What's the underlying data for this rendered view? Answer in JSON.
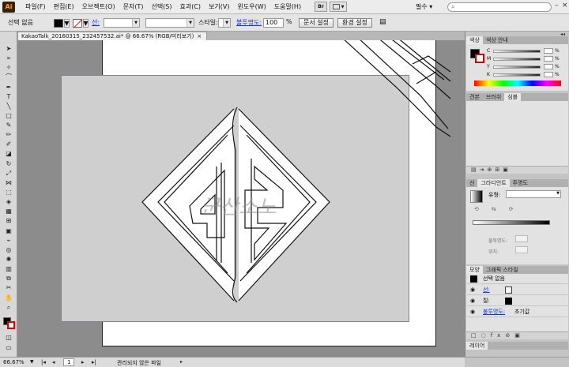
{
  "app": {
    "logo": "Ai"
  },
  "menu": [
    "파일(F)",
    "편집(E)",
    "오브젝트(O)",
    "문자(T)",
    "선택(S)",
    "효과(C)",
    "보기(V)",
    "윈도우(W)",
    "도움말(H)"
  ],
  "bridge_label": "Br",
  "workspace": "필수 ▾",
  "window_controls": {
    "min": "–",
    "max": "□",
    "close": "×"
  },
  "control": {
    "selection_label": "선택 없음",
    "stroke_label": "선:",
    "style_label": "스타일:",
    "opacity_label": "불투명도:",
    "opacity_value": "100",
    "opacity_unit": "%",
    "doc_setup": "문서 설정",
    "preferences": "환경 설정"
  },
  "document": {
    "tab_title": "KakaoTalk_20160315_232457532.ai* @ 66.67% (RGB/미리보기)",
    "close": "×"
  },
  "artwork": {
    "signature": "군산소노"
  },
  "panels": {
    "color": {
      "tabs": [
        "색상",
        "색상 안내"
      ],
      "channels": [
        {
          "label": "C",
          "unit": "%"
        },
        {
          "label": "M",
          "unit": "%"
        },
        {
          "label": "Y",
          "unit": "%"
        },
        {
          "label": "K",
          "unit": "%"
        }
      ]
    },
    "swatches": {
      "tabs": [
        "견본",
        "브러쉬",
        "심볼"
      ]
    },
    "gradient": {
      "tabs": [
        "선",
        "그라디언트",
        "투명도"
      ],
      "type_label": "유형:",
      "opacity_label": "불투명도:",
      "location_label": "위치:"
    },
    "appearance": {
      "tabs": [
        "모양",
        "그래픽 스타일"
      ],
      "title": "선택 없음",
      "rows": [
        {
          "label": "선:"
        },
        {
          "label": "칠:"
        },
        {
          "label": "불투명도:",
          "value": "초기값"
        }
      ]
    },
    "layers": {
      "tab": "레이어"
    }
  },
  "status": {
    "zoom": "66.67%",
    "page": "1",
    "message": "관리되지 않은 파일"
  }
}
